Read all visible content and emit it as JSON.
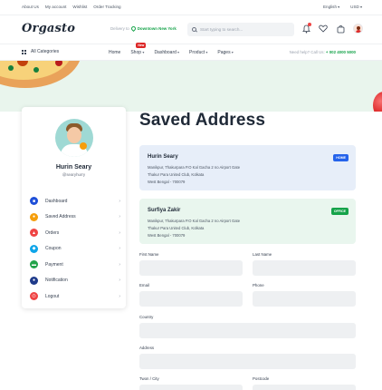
{
  "topbar": {
    "links": [
      "About Us",
      "My account",
      "Wishlist",
      "Order Tracking"
    ],
    "language": "English",
    "currency": "USD"
  },
  "header": {
    "logo": "Orgasto",
    "delivery_label": "Delivery to",
    "delivery_location": "Downtown New York",
    "search_placeholder": "Start typing to search..."
  },
  "nav": {
    "categories_label": "All Categories",
    "items": [
      "Home",
      "Shop",
      "Dashboard",
      "Product",
      "Pages"
    ],
    "new_badge": "New",
    "support_label": "Need help? Call Us:",
    "support_number": "+ 002 4000 5000"
  },
  "page": {
    "title": "Saved Address"
  },
  "sidebar": {
    "name": "Hurin Seary",
    "handle": "@searyhurry",
    "items": [
      {
        "label": "Dashboard",
        "color": "#1e4fd8"
      },
      {
        "label": "Saved Address",
        "color": "#f59e0b"
      },
      {
        "label": "Orders",
        "color": "#ef4444"
      },
      {
        "label": "Coupon",
        "color": "#0ea5e9"
      },
      {
        "label": "Payment",
        "color": "#22a34a"
      },
      {
        "label": "Notification",
        "color": "#1e3a8a"
      },
      {
        "label": "Logout",
        "color": "#ef4444"
      }
    ]
  },
  "addresses": [
    {
      "name": "Hurin Seary",
      "tag": "HOME",
      "tag_color": "#2563eb",
      "lines": [
        "Manikpur, Thakurpara P.O Kal Gacha 2 no Airport Gate",
        "Thakur Para United Club, Kolkata",
        "West Bengal - 700079"
      ]
    },
    {
      "name": "Surfiya Zakir",
      "tag": "OFFICE",
      "tag_color": "#16a34a",
      "lines": [
        "Manikpur, Thakurpara P.O Kal Gacha 2 no Airport Gate",
        "Thakur Para United Club, Kolkata",
        "West Bengal - 700079"
      ]
    }
  ],
  "form": {
    "first_name": "First Name",
    "last_name": "Last Name",
    "email": "Email",
    "phone": "Phone",
    "country": "Country",
    "address": "Address",
    "town_city": "Twon / City",
    "postcode": "Postcode"
  }
}
